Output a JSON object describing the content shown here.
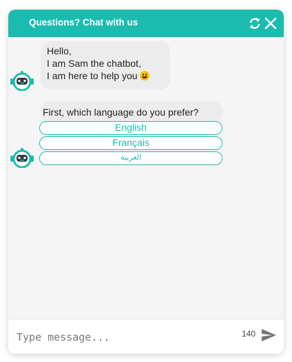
{
  "header": {
    "title": "Questions? Chat with us"
  },
  "messages": {
    "greeting": {
      "line1": "Hello,",
      "line2": "I am Sam the chatbot,",
      "line3": "I am here to help you"
    },
    "language_prompt": "First, which language do you prefer?"
  },
  "options": [
    {
      "label": "English"
    },
    {
      "label": "Français"
    },
    {
      "label": "العربية"
    }
  ],
  "footer": {
    "placeholder": "Type message...",
    "char_count": "140"
  },
  "colors": {
    "accent": "#1bbcaf",
    "bubble": "#ececec",
    "panel": "#f5f5f5"
  },
  "icons": [
    "refresh-icon",
    "close-icon",
    "chatbot-avatar-icon",
    "grinning-emoji-icon",
    "send-icon"
  ]
}
